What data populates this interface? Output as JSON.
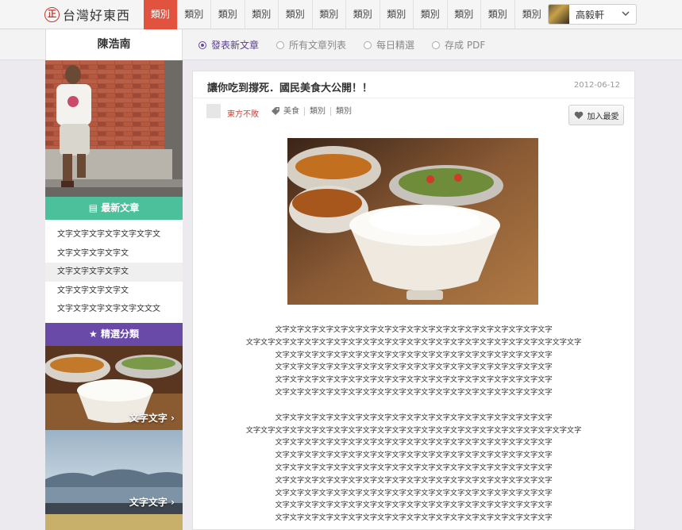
{
  "site": {
    "logo_mark": "正",
    "name": "台灣好東西"
  },
  "nav": {
    "tabs": [
      "類別",
      "類別",
      "類別",
      "類別",
      "類別",
      "類別",
      "類別",
      "類別",
      "類別",
      "類別",
      "類別",
      "類別"
    ],
    "active_index": 0
  },
  "user": {
    "name": "高毅軒"
  },
  "subnav": {
    "author": "陳浩南",
    "options": [
      {
        "label": "發表新文章",
        "checked": true
      },
      {
        "label": "所有文章列表",
        "checked": false
      },
      {
        "label": "每日精選",
        "checked": false
      },
      {
        "label": "存成 PDF",
        "checked": false
      }
    ]
  },
  "sidebar": {
    "latest_title": "最新文章",
    "latest_items": [
      "文字文字文字文字文字文字文",
      "文字文字文字文字文",
      "文字文字文字文字文",
      "文字文字文字文字文",
      "文字文字文字文字文字文文文"
    ],
    "featured_title": "精選分類",
    "categories": [
      {
        "label": "文字文字"
      },
      {
        "label": "文字文字"
      }
    ]
  },
  "article": {
    "title": "讓你吃到撐死．國民美食大公開！！",
    "date": "2012-06-12",
    "author": "東方不敗",
    "tags": [
      "美食",
      "類別",
      "類別"
    ],
    "favorite_label": "加入最愛",
    "paragraphs": [
      [
        "文字文字文字文字文字文字文字文字文字文字文字文字文字文字文字文字文字文字文字",
        "文字文字文字文字文字文字文字文字文字文字文字文字文字文字文字文字文字文字文字文字文字文字文字",
        "文字文字文字文字文字文字文字文字文字文字文字文字文字文字文字文字文字文字文字",
        "文字文字文字文字文字文字文字文字文字文字文字文字文字文字文字文字文字文字文字",
        "文字文字文字文字文字文字文字文字文字文字文字文字文字文字文字文字文字文字文字",
        "文字文字文字文字文字文字文字文字文字文字文字文字文字文字文字文字文字文字文字"
      ],
      [
        "文字文字文字文字文字文字文字文字文字文字文字文字文字文字文字文字文字文字文字",
        "文字文字文字文字文字文字文字文字文字文字文字文字文字文字文字文字文字文字文字文字文字文字文字",
        "文字文字文字文字文字文字文字文字文字文字文字文字文字文字文字文字文字文字文字",
        "文字文字文字文字文字文字文字文字文字文字文字文字文字文字文字文字文字文字文字",
        "文字文字文字文字文字文字文字文字文字文字文字文字文字文字文字文字文字文字文字",
        "文字文字文字文字文字文字文字文字文字文字文字文字文字文字文字文字文字文字文字",
        "文字文字文字文字文字文字文字文字文字文字文字文字文字文字文字文字文字文字文字",
        "文字文字文字文字文字文字文字文字文字文字文字文字文字文字文字文字文字文字文字",
        "文字文字文字文字文字文字文字文字文字文字文字文字文字文字文字文字文字文字文字"
      ]
    ]
  },
  "colors": {
    "accent_red": "#e2533f",
    "green": "#4cc09a",
    "purple": "#6a4aa8"
  },
  "icons": {
    "dropdown": "chevron-down-icon",
    "tag": "tag-icon",
    "favorite": "heart-icon",
    "list": "document-icon",
    "featured": "star-icon"
  }
}
